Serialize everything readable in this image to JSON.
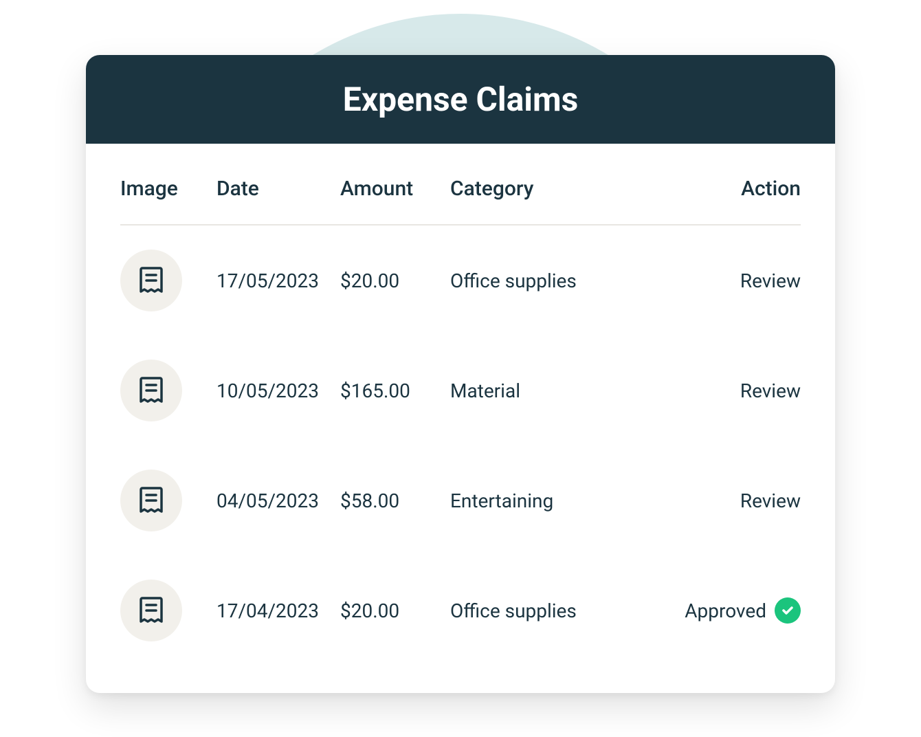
{
  "title": "Expense Claims",
  "columns": {
    "image": "Image",
    "date": "Date",
    "amount": "Amount",
    "category": "Category",
    "action": "Action"
  },
  "rows": [
    {
      "date": "17/05/2023",
      "amount": "$20.00",
      "category": "Office supplies",
      "action": "Review",
      "approved": false
    },
    {
      "date": "10/05/2023",
      "amount": "$165.00",
      "category": "Material",
      "action": "Review",
      "approved": false
    },
    {
      "date": "04/05/2023",
      "amount": "$58.00",
      "category": "Entertaining",
      "action": "Review",
      "approved": false
    },
    {
      "date": "17/04/2023",
      "amount": "$20.00",
      "category": "Office supplies",
      "action": "Approved",
      "approved": true
    }
  ]
}
